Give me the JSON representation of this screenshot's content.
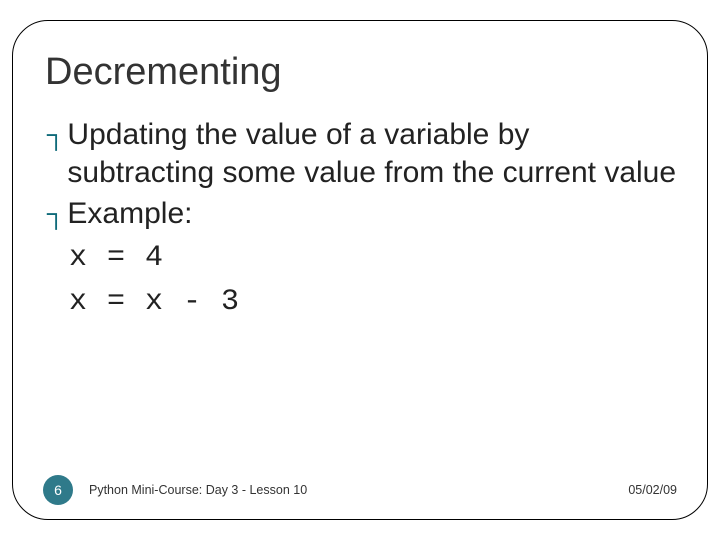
{
  "slide": {
    "title": "Decrementing",
    "bullets": [
      {
        "glyph": "┐",
        "text": "Updating the value of a variable by subtracting some value from the current value"
      },
      {
        "glyph": "┐",
        "text": "Example:"
      }
    ],
    "code": [
      "x = 4",
      "x = x - 3"
    ]
  },
  "footer": {
    "page": "6",
    "course": "Python Mini-Course: Day 3 - Lesson 10",
    "date": "05/02/09"
  }
}
